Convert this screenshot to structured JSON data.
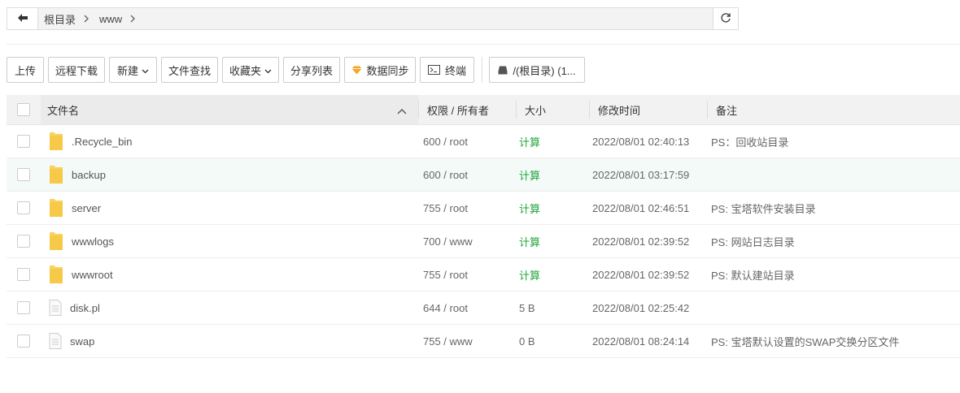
{
  "path": {
    "crumbs": [
      "根目录",
      "www"
    ]
  },
  "toolbar": {
    "upload": "上传",
    "remote_download": "远程下载",
    "new": "新建",
    "file_search": "文件查找",
    "favorites": "收藏夹",
    "share_list": "分享列表",
    "data_sync": "数据同步",
    "terminal": "终端",
    "disk": "/(根目录) (1..."
  },
  "table": {
    "headers": {
      "name": "文件名",
      "perm": "权限 / 所有者",
      "size": "大小",
      "mtime": "修改时间",
      "note": "备注"
    },
    "rows": [
      {
        "type": "folder",
        "name": ".Recycle_bin",
        "perm": "600 / root",
        "size": "计算",
        "mtime": "2022/08/01 02:40:13",
        "note": "PS：回收站目录"
      },
      {
        "type": "folder",
        "name": "backup",
        "perm": "600 / root",
        "size": "计算",
        "mtime": "2022/08/01 03:17:59",
        "note": ""
      },
      {
        "type": "folder",
        "name": "server",
        "perm": "755 / root",
        "size": "计算",
        "mtime": "2022/08/01 02:46:51",
        "note": "PS: 宝塔软件安装目录"
      },
      {
        "type": "folder",
        "name": "wwwlogs",
        "perm": "700 / www",
        "size": "计算",
        "mtime": "2022/08/01 02:39:52",
        "note": "PS: 网站日志目录"
      },
      {
        "type": "folder",
        "name": "wwwroot",
        "perm": "755 / root",
        "size": "计算",
        "mtime": "2022/08/01 02:39:52",
        "note": "PS: 默认建站目录"
      },
      {
        "type": "file",
        "name": "disk.pl",
        "perm": "644 / root",
        "size": "5 B",
        "mtime": "2022/08/01 02:25:42",
        "note": ""
      },
      {
        "type": "file",
        "name": "swap",
        "perm": "755 / www",
        "size": "0 B",
        "mtime": "2022/08/01 08:24:14",
        "note": "PS: 宝塔默认设置的SWAP交换分区文件"
      }
    ]
  },
  "colors": {
    "accent_green": "#20a53a",
    "folder_yellow": "#f7c948",
    "highlight_row": "#f3faf8"
  }
}
